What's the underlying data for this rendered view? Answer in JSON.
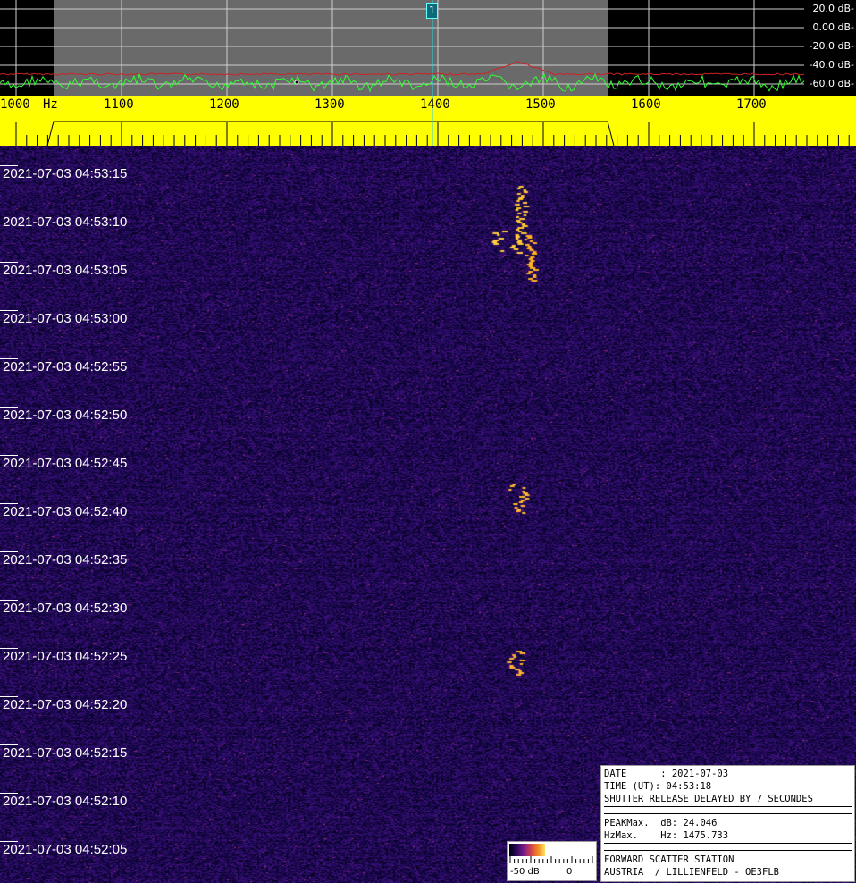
{
  "spectrum": {
    "db_labels": [
      "20.0 dB-",
      "0.00 dB-",
      "-20.0 dB-",
      "-40.0 dB-",
      "-60.0 dB-"
    ],
    "marker_label": "1"
  },
  "ruler": {
    "unit": "Hz",
    "frequencies": [
      "1000",
      "1100",
      "1200",
      "1300",
      "1400",
      "1500",
      "1600",
      "1700"
    ]
  },
  "waterfall": {
    "timestamps": [
      "2021-07-03 04:53:15",
      "2021-07-03 04:53:10",
      "2021-07-03 04:53:05",
      "2021-07-03 04:53:00",
      "2021-07-03 04:52:55",
      "2021-07-03 04:52:50",
      "2021-07-03 04:52:45",
      "2021-07-03 04:52:40",
      "2021-07-03 04:52:35",
      "2021-07-03 04:52:30",
      "2021-07-03 04:52:25",
      "2021-07-03 04:52:20",
      "2021-07-03 04:52:15",
      "2021-07-03 04:52:10",
      "2021-07-03 04:52:05"
    ]
  },
  "info": {
    "date_line": "DATE      : 2021-07-03",
    "time_line": "TIME (UT): 04:53:18",
    "shutter_line": "SHUTTER RELEASE DELAYED BY 7 SECONDES",
    "peak_db_line": "PEAKMax.  dB: 24.046",
    "peak_hz_line": "HzMax.    Hz: 1475.733",
    "station_line": "FORWARD SCATTER STATION",
    "location_line": "AUSTRIA  / LILLIENFELD - OE3FLB"
  },
  "scale": {
    "min_label": "-50 dB",
    "max_label": "0"
  },
  "colors": {
    "ruler_bg": "#ffff00",
    "passband": "#6a6a6a",
    "trace_green": "#33ff33",
    "trace_red": "#cc2222",
    "marker": "#2ad4e0"
  }
}
